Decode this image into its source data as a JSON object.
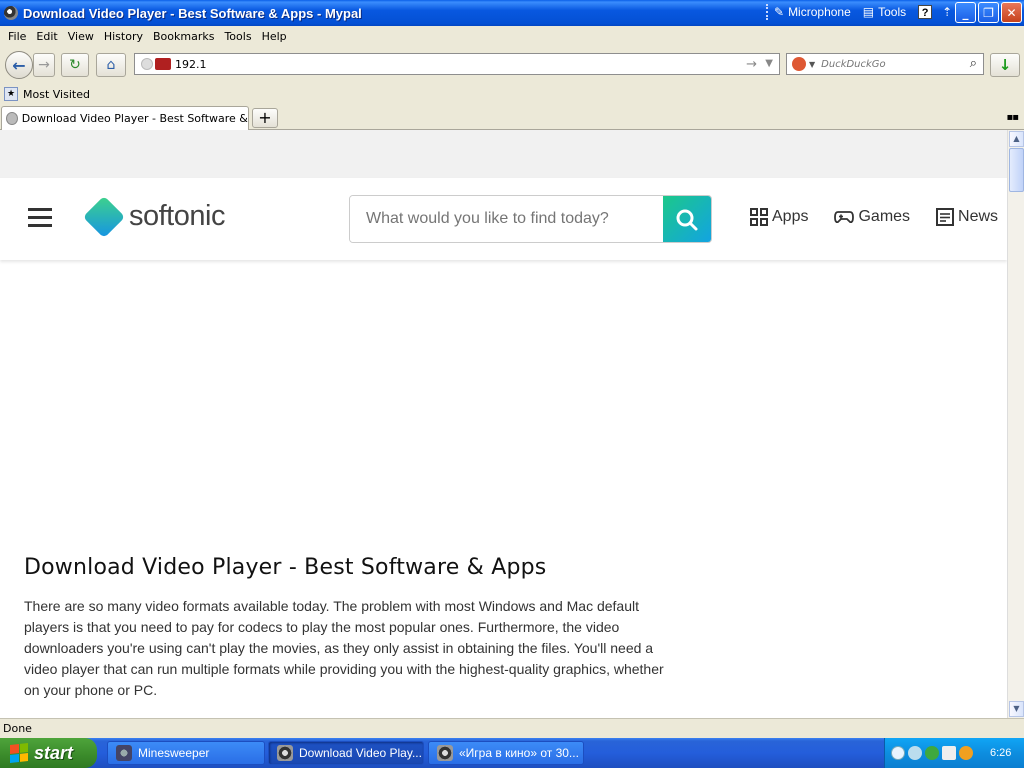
{
  "window": {
    "title": "Download Video Player - Best Software & Apps - Mypal",
    "extras": {
      "microphone": "Microphone",
      "tools": "Tools",
      "help": "?"
    }
  },
  "menu": [
    "File",
    "Edit",
    "View",
    "History",
    "Bookmarks",
    "Tools",
    "Help"
  ],
  "nav": {
    "url_value": "192.1",
    "search_placeholder": "DuckDuckGo"
  },
  "bookmarks": {
    "most_visited": "Most Visited"
  },
  "tabs": [
    {
      "title": "Download Video Player - Best Software & Ap..."
    }
  ],
  "site": {
    "logo_text": "softonic",
    "search_placeholder": "What would you like to find today?",
    "nav": {
      "apps": "Apps",
      "games": "Games",
      "news": "News"
    },
    "article_title": "Download Video Player - Best Software & Apps",
    "article_body": "There are so many video formats available today. The problem with most Windows and Mac default players is that you need to pay for codecs to play the most popular ones. Furthermore, the video downloaders you're using can't play the movies, as they only assist in obtaining the files. You'll need a video player that can run multiple formats while providing you with the highest-quality graphics, whether on your phone or PC."
  },
  "status": "Done",
  "taskbar": {
    "start": "start",
    "tasks": [
      {
        "label": "Minesweeper"
      },
      {
        "label": "Download Video Play..."
      },
      {
        "label": "«Игра в кино» от 30..."
      }
    ],
    "clock": "6:26"
  }
}
